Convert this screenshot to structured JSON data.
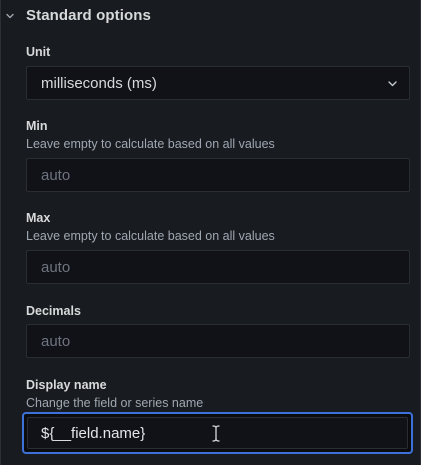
{
  "section": {
    "title": "Standard options",
    "expanded": true
  },
  "unit": {
    "label": "Unit",
    "value": "milliseconds (ms)"
  },
  "min": {
    "label": "Min",
    "description": "Leave empty to calculate based on all values",
    "placeholder": "auto"
  },
  "max": {
    "label": "Max",
    "description": "Leave empty to calculate based on all values",
    "placeholder": "auto"
  },
  "decimals": {
    "label": "Decimals",
    "placeholder": "auto"
  },
  "display_name": {
    "label": "Display name",
    "description": "Change the field or series name",
    "value": "${__field.name}"
  },
  "icons": {
    "section_toggle": "chevron-down-icon",
    "unit_dropdown": "chevron-down-icon",
    "mouse_cursor": "text-cursor-icon"
  },
  "colors": {
    "background": "#181b1f",
    "input_background": "#111217",
    "focus_ring": "#3d71d9",
    "text_primary": "#d8d9da",
    "text_secondary": "#9fa7b3",
    "placeholder": "#6e7480"
  }
}
